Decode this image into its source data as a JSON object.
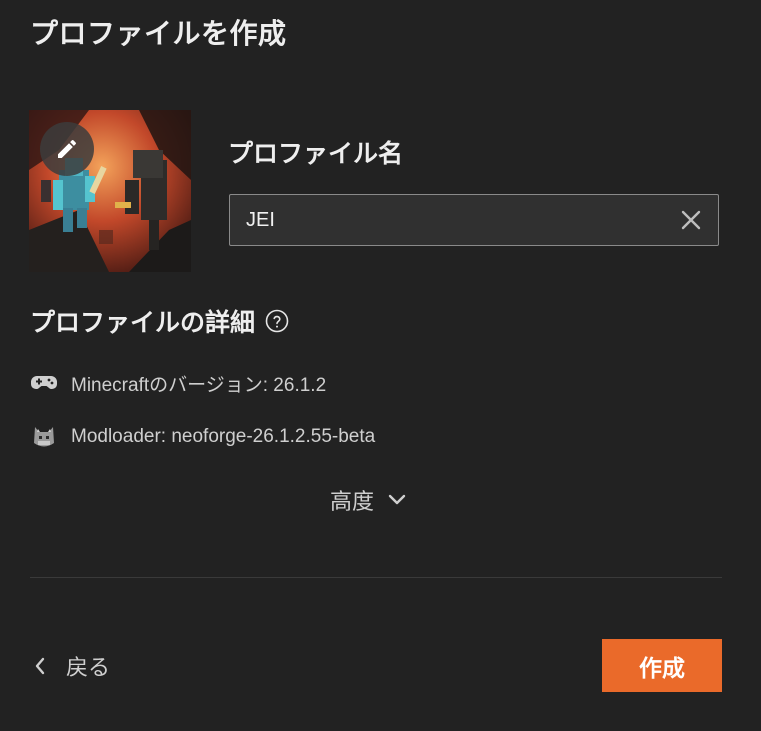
{
  "dialog": {
    "title": "プロファイルを作成"
  },
  "profile": {
    "image_alt": "Minecraft nether artwork",
    "edit_icon": "pencil-icon",
    "name_label": "プロファイル名",
    "name_value": "JEI",
    "clear_icon": "close-icon"
  },
  "details": {
    "heading": "プロファイルの詳細",
    "help_icon": "question-circle-icon",
    "version_icon": "gamepad-icon",
    "version_text": "Minecraftのバージョン: 26.1.2",
    "modloader_icon": "neoforge-fox-icon",
    "modloader_text": "Modloader: neoforge-26.1.2.55-beta"
  },
  "advanced": {
    "label": "高度",
    "icon": "chevron-down-icon"
  },
  "footer": {
    "back_label": "戻る",
    "back_icon": "chevron-left-icon",
    "create_label": "作成"
  },
  "colors": {
    "background": "#222222",
    "accent": "#ea6a2a",
    "input_bg": "#303030",
    "input_border": "#8a8a8a"
  }
}
